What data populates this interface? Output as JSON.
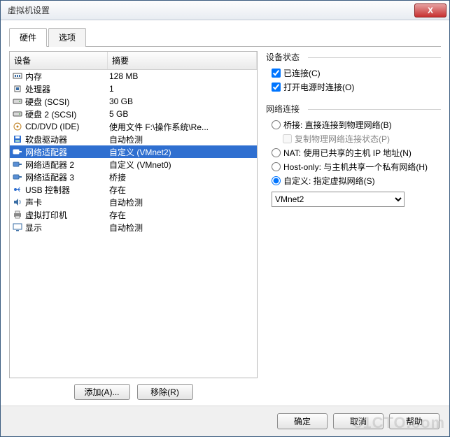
{
  "window": {
    "title": "虚拟机设置",
    "close": "X"
  },
  "tabs": {
    "hardware": "硬件",
    "options": "选项",
    "active": 0
  },
  "list": {
    "header_device": "设备",
    "header_summary": "摘要",
    "rows": [
      {
        "icon": "memory-icon",
        "device": "内存",
        "summary": "128 MB"
      },
      {
        "icon": "cpu-icon",
        "device": "处理器",
        "summary": "1"
      },
      {
        "icon": "hdd-icon",
        "device": "硬盘 (SCSI)",
        "summary": "30 GB"
      },
      {
        "icon": "hdd-icon",
        "device": "硬盘 2 (SCSI)",
        "summary": "5 GB"
      },
      {
        "icon": "cd-icon",
        "device": "CD/DVD (IDE)",
        "summary": "使用文件 F:\\操作系统\\Re..."
      },
      {
        "icon": "floppy-icon",
        "device": "软盘驱动器",
        "summary": "自动检测"
      },
      {
        "icon": "network-icon",
        "device": "网络适配器",
        "summary": "自定义 (VMnet2)",
        "selected": true
      },
      {
        "icon": "network-icon",
        "device": "网络适配器 2",
        "summary": "自定义 (VMnet0)"
      },
      {
        "icon": "network-icon",
        "device": "网络适配器 3",
        "summary": "桥接"
      },
      {
        "icon": "usb-icon",
        "device": "USB 控制器",
        "summary": "存在"
      },
      {
        "icon": "sound-icon",
        "device": "声卡",
        "summary": "自动检测"
      },
      {
        "icon": "printer-icon",
        "device": "虚拟打印机",
        "summary": "存在"
      },
      {
        "icon": "display-icon",
        "device": "显示",
        "summary": "自动检测"
      }
    ],
    "add_btn": "添加(A)...",
    "remove_btn": "移除(R)"
  },
  "status": {
    "title": "设备状态",
    "connected": "已连接(C)",
    "connect_at_poweron": "打开电源时连接(O)"
  },
  "network": {
    "title": "网络连接",
    "bridged": "桥接: 直接连接到物理网络(B)",
    "replicate": "复制物理网络连接状态(P)",
    "nat": "NAT: 使用已共享的主机 IP 地址(N)",
    "hostonly": "Host-only: 与主机共享一个私有网络(H)",
    "custom": "自定义: 指定虚拟网络(S)",
    "selected": "custom",
    "vmnet_value": "VMnet2"
  },
  "footer": {
    "ok": "确定",
    "cancel": "取消",
    "help": "帮助"
  },
  "watermark": "51CTO.com"
}
